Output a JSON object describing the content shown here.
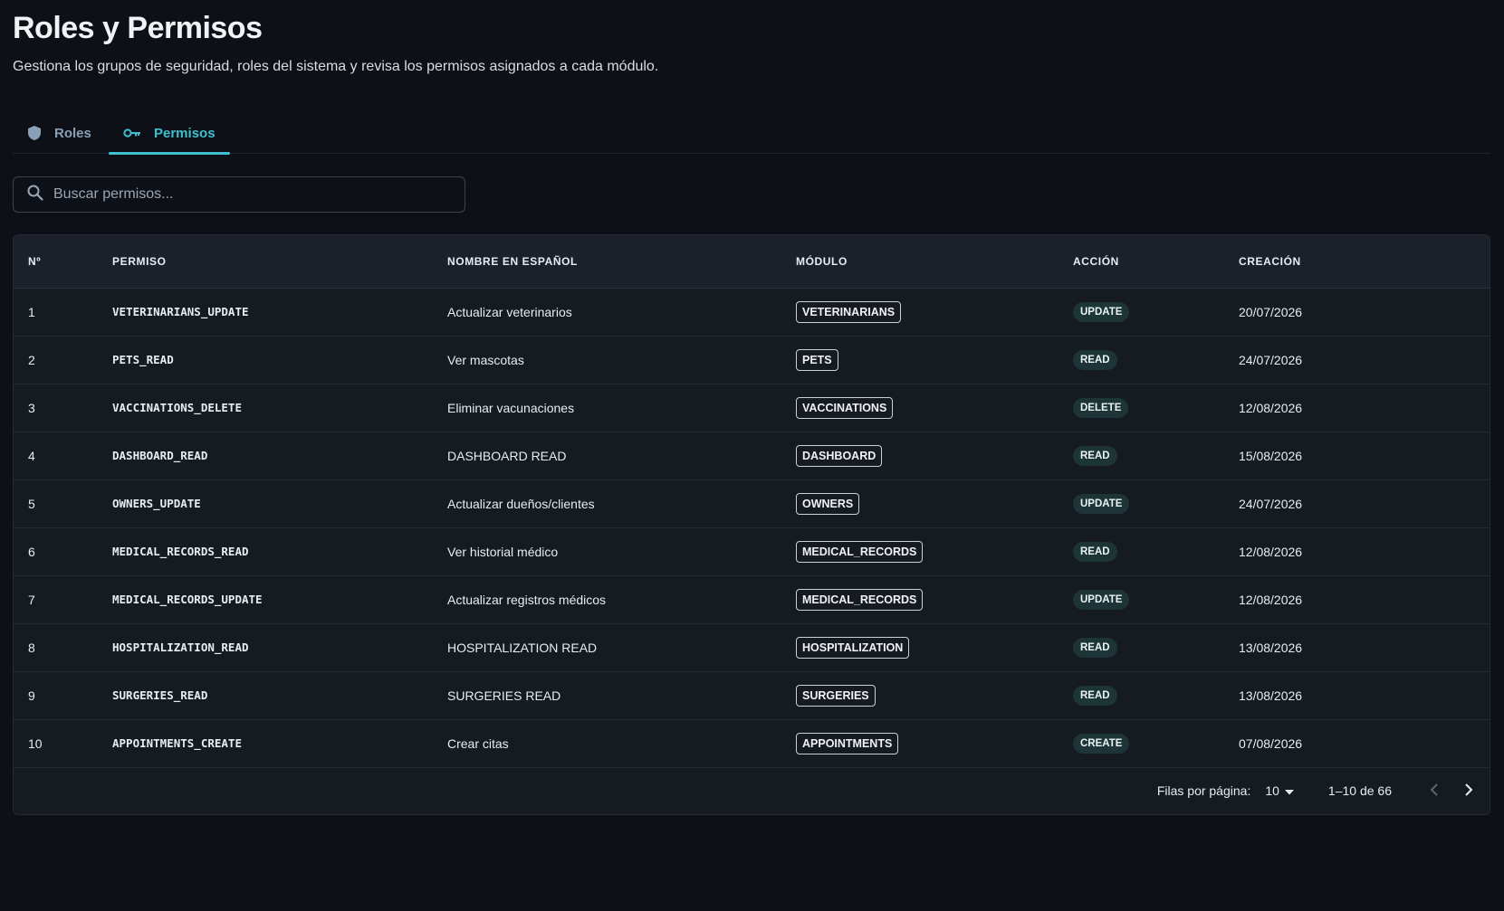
{
  "header": {
    "title": "Roles y Permisos",
    "subtitle": "Gestiona los grupos de seguridad, roles del sistema y revisa los permisos asignados a cada módulo."
  },
  "tabs": [
    {
      "label": "Roles",
      "icon": "shield-icon",
      "active": false
    },
    {
      "label": "Permisos",
      "icon": "key-icon",
      "active": true
    }
  ],
  "search": {
    "placeholder": "Buscar permisos...",
    "value": ""
  },
  "table": {
    "columns": [
      "Nº",
      "PERMISO",
      "NOMBRE EN ESPAÑOL",
      "MÓDULO",
      "ACCIÓN",
      "CREACIÓN"
    ],
    "rows": [
      {
        "n": "1",
        "permission": "VETERINARIANS_UPDATE",
        "name": "Actualizar veterinarios",
        "module": "VETERINARIANS",
        "action": "UPDATE",
        "created": "20/07/2026"
      },
      {
        "n": "2",
        "permission": "PETS_READ",
        "name": "Ver mascotas",
        "module": "PETS",
        "action": "READ",
        "created": "24/07/2026"
      },
      {
        "n": "3",
        "permission": "VACCINATIONS_DELETE",
        "name": "Eliminar vacunaciones",
        "module": "VACCINATIONS",
        "action": "DELETE",
        "created": "12/08/2026"
      },
      {
        "n": "4",
        "permission": "DASHBOARD_READ",
        "name": "DASHBOARD READ",
        "module": "DASHBOARD",
        "action": "READ",
        "created": "15/08/2026"
      },
      {
        "n": "5",
        "permission": "OWNERS_UPDATE",
        "name": "Actualizar dueños/clientes",
        "module": "OWNERS",
        "action": "UPDATE",
        "created": "24/07/2026"
      },
      {
        "n": "6",
        "permission": "MEDICAL_RECORDS_READ",
        "name": "Ver historial médico",
        "module": "MEDICAL_RECORDS",
        "action": "READ",
        "created": "12/08/2026"
      },
      {
        "n": "7",
        "permission": "MEDICAL_RECORDS_UPDATE",
        "name": "Actualizar registros médicos",
        "module": "MEDICAL_RECORDS",
        "action": "UPDATE",
        "created": "12/08/2026"
      },
      {
        "n": "8",
        "permission": "HOSPITALIZATION_READ",
        "name": "HOSPITALIZATION READ",
        "module": "HOSPITALIZATION",
        "action": "READ",
        "created": "13/08/2026"
      },
      {
        "n": "9",
        "permission": "SURGERIES_READ",
        "name": "SURGERIES READ",
        "module": "SURGERIES",
        "action": "READ",
        "created": "13/08/2026"
      },
      {
        "n": "10",
        "permission": "APPOINTMENTS_CREATE",
        "name": "Crear citas",
        "module": "APPOINTMENTS",
        "action": "CREATE",
        "created": "07/08/2026"
      }
    ]
  },
  "pagination": {
    "rows_label": "Filas por página:",
    "rows_per_page": "10",
    "range": "1–10 de 66",
    "prev_icon": "chevron-left-icon",
    "next_icon": "chevron-right-icon"
  },
  "colors": {
    "background": "#0d1117",
    "accent": "#3fc0d0",
    "table_bg": "#161b22",
    "action_chip_bg": "#1d3536"
  }
}
